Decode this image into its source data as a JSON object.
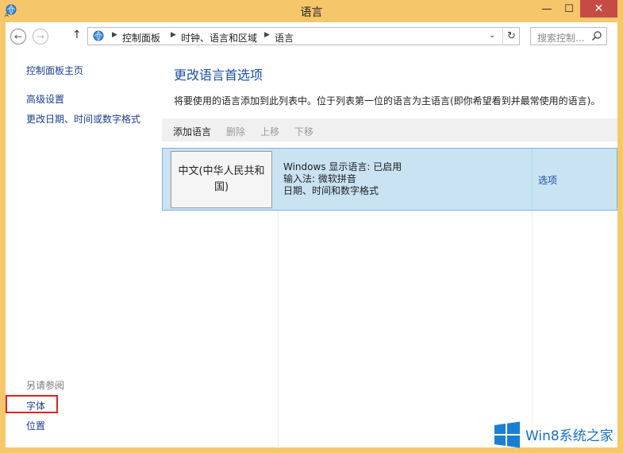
{
  "window": {
    "title": "语言",
    "min_glyph": "—",
    "max_glyph": "☐",
    "close_glyph": "✕"
  },
  "nav": {
    "back_glyph": "←",
    "forward_glyph": "→",
    "up_glyph": "↑",
    "breadcrumbs": [
      "控制面板",
      "时钟、语言和区域",
      "语言"
    ],
    "dropdown_glyph": "⌄",
    "refresh_glyph": "↻",
    "search_placeholder": "搜索控制..."
  },
  "sidebar": {
    "home": "控制面板主页",
    "advanced": "高级设置",
    "datetime": "更改日期、时间或数字格式",
    "see_also": "另请参阅",
    "fonts": "字体",
    "location": "位置"
  },
  "main": {
    "heading": "更改语言首选项",
    "description": "将要使用的语言添加到此列表中。位于列表第一位的语言为主语言(即你希望看到并最常使用的语言)。",
    "toolbar": {
      "add": "添加语言",
      "remove": "删除",
      "move_up": "上移",
      "move_down": "下移"
    },
    "languages": [
      {
        "name": "中文(中华人民共和国)",
        "details": [
          "Windows 显示语言: 已启用",
          "输入法: 微软拼音",
          "日期、时间和数字格式"
        ],
        "options": "选项"
      }
    ]
  },
  "watermark": {
    "text": "Win8系统之家"
  },
  "colors": {
    "frame": "#f5c66a",
    "link": "#1a3e8c",
    "heading": "#1a4fa0",
    "selected_row": "#c9e3f3",
    "close_button": "#c74b45",
    "highlight_box": "#e02020"
  }
}
